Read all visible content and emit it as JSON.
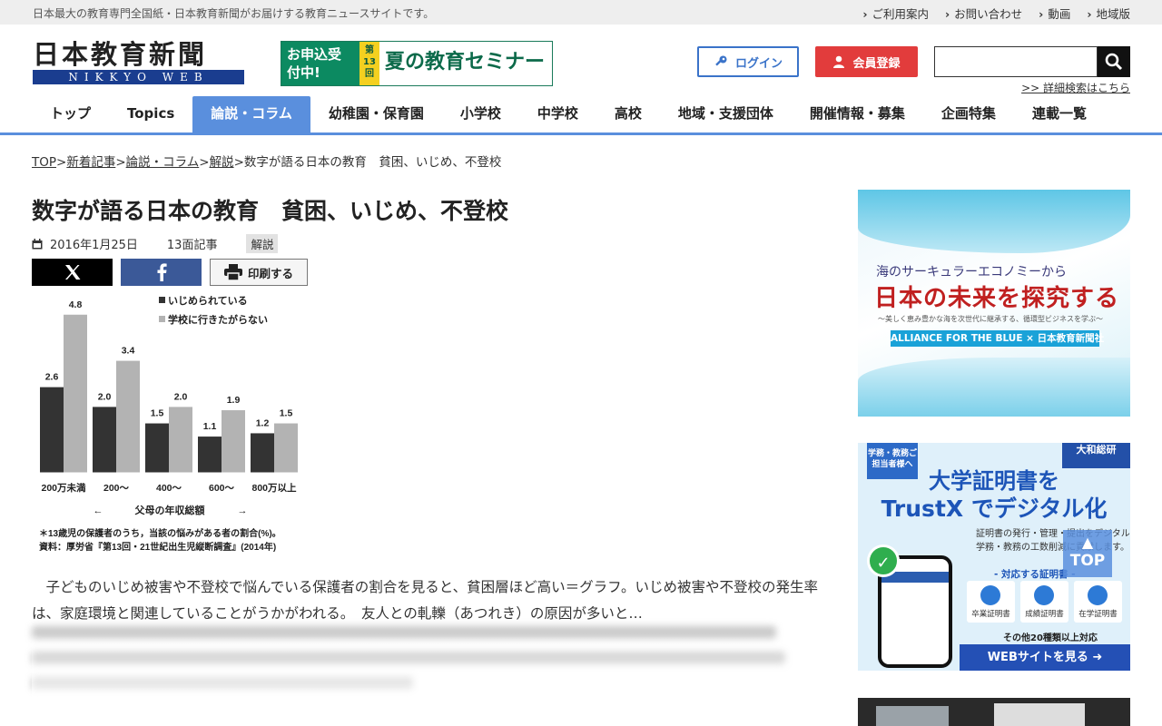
{
  "topbar": {
    "tagline": "日本最大の教育専門全国紙・日本教育新聞がお届けする教育ニュースサイトです。",
    "links": [
      "ご利用案内",
      "お問い合わせ",
      "動画",
      "地域版"
    ]
  },
  "header": {
    "logo_kanji": "日本教育新聞",
    "logo_roman": "NIKKYO WEB",
    "seminar_banner": {
      "apply": "お申込受付中!",
      "edition": "第13回",
      "title": "夏の教育セミナー"
    },
    "login_label": "ログイン",
    "signup_label": "会員登録",
    "search_placeholder": "",
    "advanced_search": ">> 詳細検索はこちら"
  },
  "nav": {
    "items": [
      "トップ",
      "Topics",
      "論説・コラム",
      "幼稚園・保育園",
      "小学校",
      "中学校",
      "高校",
      "地域・支援団体",
      "開催情報・募集",
      "企画特集",
      "連載一覧"
    ],
    "active_index": 2
  },
  "breadcrumb": {
    "items": [
      "TOP",
      "新着記事",
      "論説・コラム",
      "解説"
    ],
    "current": "数字が語る日本の教育　貧困、いじめ、不登校",
    "separator": ">"
  },
  "article": {
    "title": "数字が語る日本の教育　貧困、いじめ、不登校",
    "date": "2016年1月25日",
    "page": "13面記事",
    "category": "解説",
    "print_label": "印刷する",
    "body": "子どものいじめ被害や不登校で悩んでいる保護者の割合を見ると、貧困層ほど高い＝グラフ。いじめ被害や不登校の発生率は、家庭環境と関連していることがうかがわれる。　友人との軋轢（あつれき）の原因が多いと…"
  },
  "chart_data": {
    "type": "bar",
    "categories": [
      "200万未満",
      "200～",
      "400～",
      "600～",
      "800万以上"
    ],
    "series": [
      {
        "name": "いじめられている",
        "color": "#333333",
        "values": [
          2.6,
          2.0,
          1.5,
          1.1,
          1.2
        ]
      },
      {
        "name": "学校に行きたがらない",
        "color": "#b3b3b3",
        "values": [
          4.8,
          3.4,
          2.0,
          1.9,
          1.5
        ]
      }
    ],
    "xlabel": "父母の年収総額",
    "ylim": [
      0,
      5
    ],
    "grid": false,
    "legend": "top-right",
    "note1": "＊13歳児の保護者のうち，当該の悩みがある者の割合(%)。",
    "note2": "資料：厚労省『第13回・21世紀出生児縦断調査』(2014年)"
  },
  "sidebar": {
    "ad1": {
      "line1": "海のサーキュラーエコノミーから",
      "line2": "日本の未来を探究する",
      "line3": "～美しく恵み豊かな海を次世代に継承する、循環型ビジネスを学ぶ～",
      "line4": "ALLIANCE FOR THE BLUE × 日本教育新聞社"
    },
    "ad2": {
      "badge": "学務・教務ご担当者様へ",
      "brand": "大和総研",
      "headline1": "大学証明書を",
      "headline2": "TrustX でデジタル化",
      "desc1": "証明書の発行・管理・提出をデジタル化し、",
      "desc2": "学務・教務の工数削減に貢献します。",
      "caption": "- 対応する証明書 -",
      "cards": [
        "卒業証明書",
        "成績証明書",
        "在学証明書"
      ],
      "more": "その他20種類以上対応",
      "cta": "WEBサイトを見る ➜"
    },
    "totop": "TOP"
  }
}
